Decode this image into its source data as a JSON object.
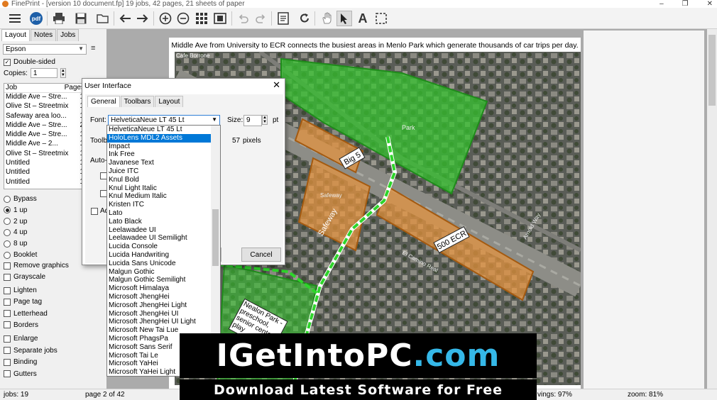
{
  "window": {
    "title": "FinePrint - [version 10 document.fp] 19 jobs, 42 pages, 21 sheets of paper",
    "controls": [
      "–",
      "❐",
      "✕"
    ]
  },
  "toolbar": {
    "icons": [
      "menu-icon",
      "pdf-icon",
      "print-icon",
      "save-icon",
      "open-folder-icon",
      "back-icon",
      "forward-icon",
      "zoom-in-icon",
      "zoom-out-icon",
      "thumbnails-icon",
      "fit-page-icon",
      "undo-icon",
      "redo-icon",
      "notes-icon",
      "refresh-icon",
      "hand-tool-icon",
      "select-tool-icon",
      "text-tool-icon",
      "crop-tool-icon"
    ],
    "pdf_label": "pdf"
  },
  "left_panel": {
    "tabs": [
      "Layout",
      "Notes",
      "Jobs"
    ],
    "printer": "Epson",
    "double_sided": {
      "label": "Double-sided",
      "checked": true
    },
    "copies": {
      "label": "Copies:",
      "value": "1"
    },
    "job_table": {
      "headers": [
        "Job",
        "Pages"
      ],
      "rows": [
        {
          "name": "Middle Ave – Stre...",
          "pages": "1"
        },
        {
          "name": "Olive St – Streetmix",
          "pages": "1"
        },
        {
          "name": "Safeway area loo...",
          "pages": "1"
        },
        {
          "name": "Middle Ave – Stre...",
          "pages": "2"
        },
        {
          "name": "Middle Ave – Stre...",
          "pages": "1"
        },
        {
          "name": "Middle Ave – 2...",
          "pages": "1"
        },
        {
          "name": "Olive St – Streetmix",
          "pages": "1"
        },
        {
          "name": "Untitled",
          "pages": "1"
        },
        {
          "name": "Untitled",
          "pages": "1"
        },
        {
          "name": "Untitled",
          "pages": "1"
        }
      ]
    },
    "layout_options": [
      {
        "label": "Bypass",
        "selected": false
      },
      {
        "label": "1 up",
        "selected": true
      },
      {
        "label": "2 up",
        "selected": false
      },
      {
        "label": "4 up",
        "selected": false
      },
      {
        "label": "8 up",
        "selected": false
      },
      {
        "label": "Booklet",
        "selected": false
      }
    ],
    "options_a": [
      "Remove graphics",
      "Grayscale"
    ],
    "options_b": [
      "Lighten",
      "Page tag",
      "Letterhead",
      "Borders"
    ],
    "options_c": [
      "Enlarge",
      "Separate jobs",
      "Binding",
      "Gutters"
    ]
  },
  "document": {
    "caption": "Middle Ave from University to ECR connects the busiest areas in Menlo Park which generate thousands of car trips per day.",
    "map_labels": {
      "big5": "Big 5",
      "safeway": "Safeway",
      "ecr": "500 ECR",
      "nealon": "Nealon Park - preschool, senior center, play",
      "cafe": "Cafe Borrone",
      "park": "Park",
      "safeway_small": "Safeway",
      "el_camino": "El Camino Real",
      "arnold": "Arnold Way"
    }
  },
  "dialog": {
    "title": "User Interface",
    "close": "✕",
    "tabs": [
      "General",
      "Toolbars",
      "Layout"
    ],
    "font_label": "Font:",
    "font_value": "HelveticaNeue LT 45 Lt",
    "size_label": "Size:",
    "size_value": "9",
    "size_unit": "pt",
    "toolbar_label": "Toolba",
    "pixels_value": "57",
    "pixels_unit": "pixels",
    "auto_label": "Auto-h",
    "adv_label": "Ad",
    "cancel_label": "Cancel"
  },
  "font_dropdown": {
    "items": [
      "HelveticaNeue LT 45 Lt",
      "HoloLens MDL2 Assets",
      "Impact",
      "Ink Free",
      "Javanese Text",
      "Juice ITC",
      "Knul Bold",
      "Knul Light Italic",
      "Knul Medium Italic",
      "Kristen ITC",
      "Lato",
      "Lato Black",
      "Leelawadee UI",
      "Leelawadee UI Semilight",
      "Lucida Console",
      "Lucida Handwriting",
      "Lucida Sans Unicode",
      "Malgun Gothic",
      "Malgun Gothic Semilight",
      "Microsoft Himalaya",
      "Microsoft JhengHei",
      "Microsoft JhengHei Light",
      "Microsoft JhengHei UI",
      "Microsoft JhengHei UI Light",
      "Microsoft New Tai Lue",
      "Microsoft PhagsPa",
      "Microsoft Sans Serif",
      "Microsoft Tai Le",
      "Microsoft YaHei",
      "Microsoft YaHei Light"
    ],
    "selected_index": 1
  },
  "statusbar": {
    "jobs": "jobs: 19",
    "page": "page 2 of 42",
    "savings": "vings: 97%",
    "zoom": "zoom: 81%"
  },
  "watermark": {
    "line1_a": "IGetIntoPC",
    "line1_b": ".com",
    "line2": "Download Latest Software for Free"
  },
  "colors": {
    "accent": "#0078d7",
    "park_green": "#2fc12a",
    "building_orange": "#e8943e",
    "watermark_blue": "#35b8e8"
  }
}
